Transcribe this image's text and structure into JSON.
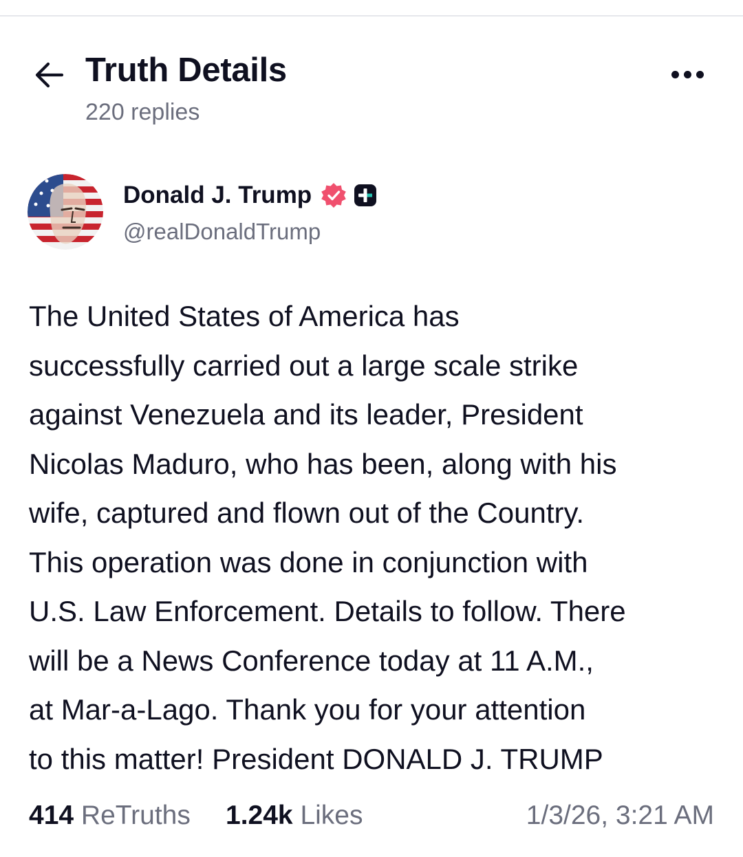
{
  "header": {
    "title": "Truth Details",
    "subtitle": "220 replies"
  },
  "post": {
    "author": {
      "name": "Donald J. Trump",
      "handle": "@realDonaldTrump"
    },
    "lines": [
      "The United States of America has",
      "successfully carried out a large scale strike",
      "against Venezuela and its leader, President",
      "Nicolas Maduro, who has been, along with his",
      "wife, captured and flown out of the Country.",
      "This operation was done in conjunction with",
      "U.S. Law Enforcement. Details to follow. There",
      "will be a News Conference today at 11 A.M.,",
      "at Mar-a-Lago. Thank you for your attention",
      "to this matter! President DONALD J. TRUMP"
    ],
    "stats": {
      "retruths_count": "414",
      "retruths_label": "ReTruths",
      "likes_count": "1.24k",
      "likes_label": "Likes",
      "timestamp": "1/3/26, 3:21 AM"
    }
  },
  "colors": {
    "text": "#0f1020",
    "muted": "#6b6e7d",
    "verified": "#f0506e",
    "divider": "#e6e7eb"
  },
  "icons": {
    "back": "arrow-left-icon",
    "more": "more-horizontal-icon",
    "verified": "verified-badge-icon",
    "plus": "truth-plus-icon"
  }
}
